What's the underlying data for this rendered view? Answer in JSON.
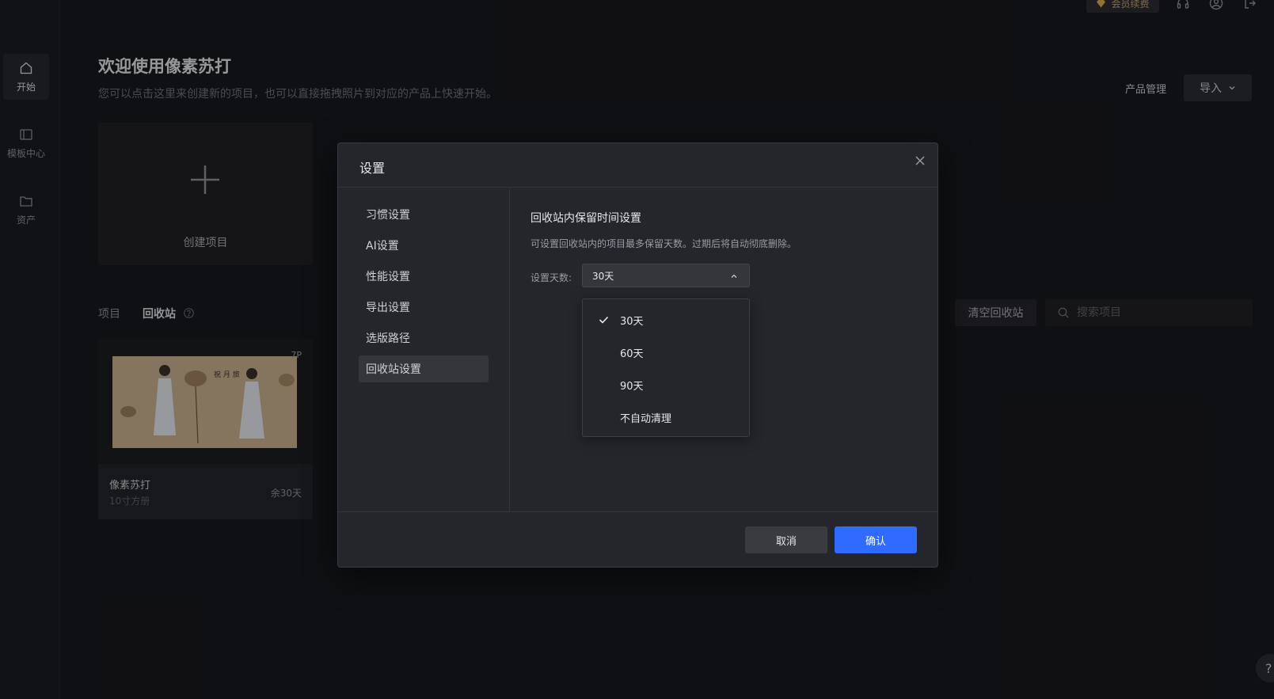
{
  "topbar": {
    "vip_label": "会员续费",
    "icons": [
      "headset-icon",
      "user-icon",
      "logout-icon"
    ]
  },
  "sidebar": {
    "items": [
      {
        "label": "开始",
        "icon": "home-icon",
        "active": true
      },
      {
        "label": "模板中心",
        "icon": "template-icon",
        "active": false
      },
      {
        "label": "资产",
        "icon": "folder-icon",
        "active": false
      }
    ]
  },
  "header": {
    "title": "欢迎使用像素苏打",
    "subtitle": "您可以点击这里来创建新的项目，也可以直接拖拽照片到对应的产品上快速开始。",
    "product_mgmt": "产品管理",
    "import_label": "导入"
  },
  "create_card": {
    "label": "创建项目"
  },
  "tabs": {
    "projects": "项目",
    "recycle": "回收站"
  },
  "recycle_toolbar": {
    "clear_label": "清空回收站",
    "search_placeholder": "搜索项目"
  },
  "project": {
    "page_count": "7P",
    "name": "像素苏打",
    "subtitle": "10寸方册",
    "days_left": "余30天"
  },
  "dialog": {
    "title": "设置",
    "menu": [
      "习惯设置",
      "AI设置",
      "性能设置",
      "导出设置",
      "选版路径",
      "回收站设置"
    ],
    "active_index": 5,
    "section_title": "回收站内保留时间设置",
    "section_desc": "可设置回收站内的项目最多保留天数。过期后将自动彻底删除。",
    "days_label": "设置天数:",
    "selected_value": "30天",
    "options": [
      "30天",
      "60天",
      "90天",
      "不自动清理"
    ],
    "cancel_label": "取消",
    "confirm_label": "确认"
  },
  "help_float": "?",
  "colors": {
    "background": "#17181c",
    "dialog": "#25262c",
    "accent": "#2f6bff",
    "vip": "#bfa06b"
  }
}
